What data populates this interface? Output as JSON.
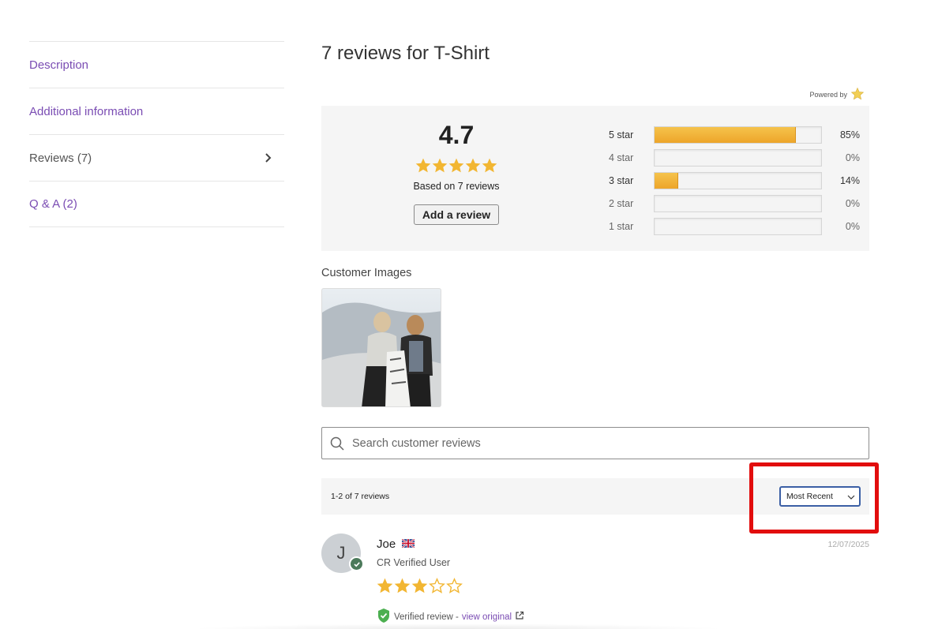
{
  "tabs": [
    {
      "label": "Description",
      "active": false
    },
    {
      "label": "Additional information",
      "active": false
    },
    {
      "label": "Reviews (7)",
      "active": true
    },
    {
      "label": "Q & A (2)",
      "active": false
    }
  ],
  "reviews_title": "7 reviews for T-Shirt",
  "powered_by": "Powered by",
  "summary": {
    "average": "4.7",
    "average_stars": 5,
    "based_on": "Based on 7 reviews",
    "add_review_label": "Add a review",
    "bars": [
      {
        "label": "5 star",
        "percent": 85,
        "pct_text": "85%"
      },
      {
        "label": "4 star",
        "percent": 0,
        "pct_text": "0%"
      },
      {
        "label": "3 star",
        "percent": 14,
        "pct_text": "14%"
      },
      {
        "label": "2 star",
        "percent": 0,
        "pct_text": "0%"
      },
      {
        "label": "1 star",
        "percent": 0,
        "pct_text": "0%"
      }
    ]
  },
  "customer_images": {
    "title": "Customer Images"
  },
  "search": {
    "placeholder": "Search customer reviews"
  },
  "toolbar": {
    "count_text": "1-2 of 7 reviews",
    "sort_value": "Most Recent"
  },
  "review": {
    "initial": "J",
    "name": "Joe",
    "role": "CR Verified User",
    "rating": 3,
    "date": "12/07/2025",
    "verified_text": "Verified review -",
    "view_original": "view original"
  },
  "colors": {
    "accent_link": "#7a4cb3",
    "star": "#f2b632",
    "highlight": "#e20d0d",
    "sort_border": "#3b5fa5"
  }
}
